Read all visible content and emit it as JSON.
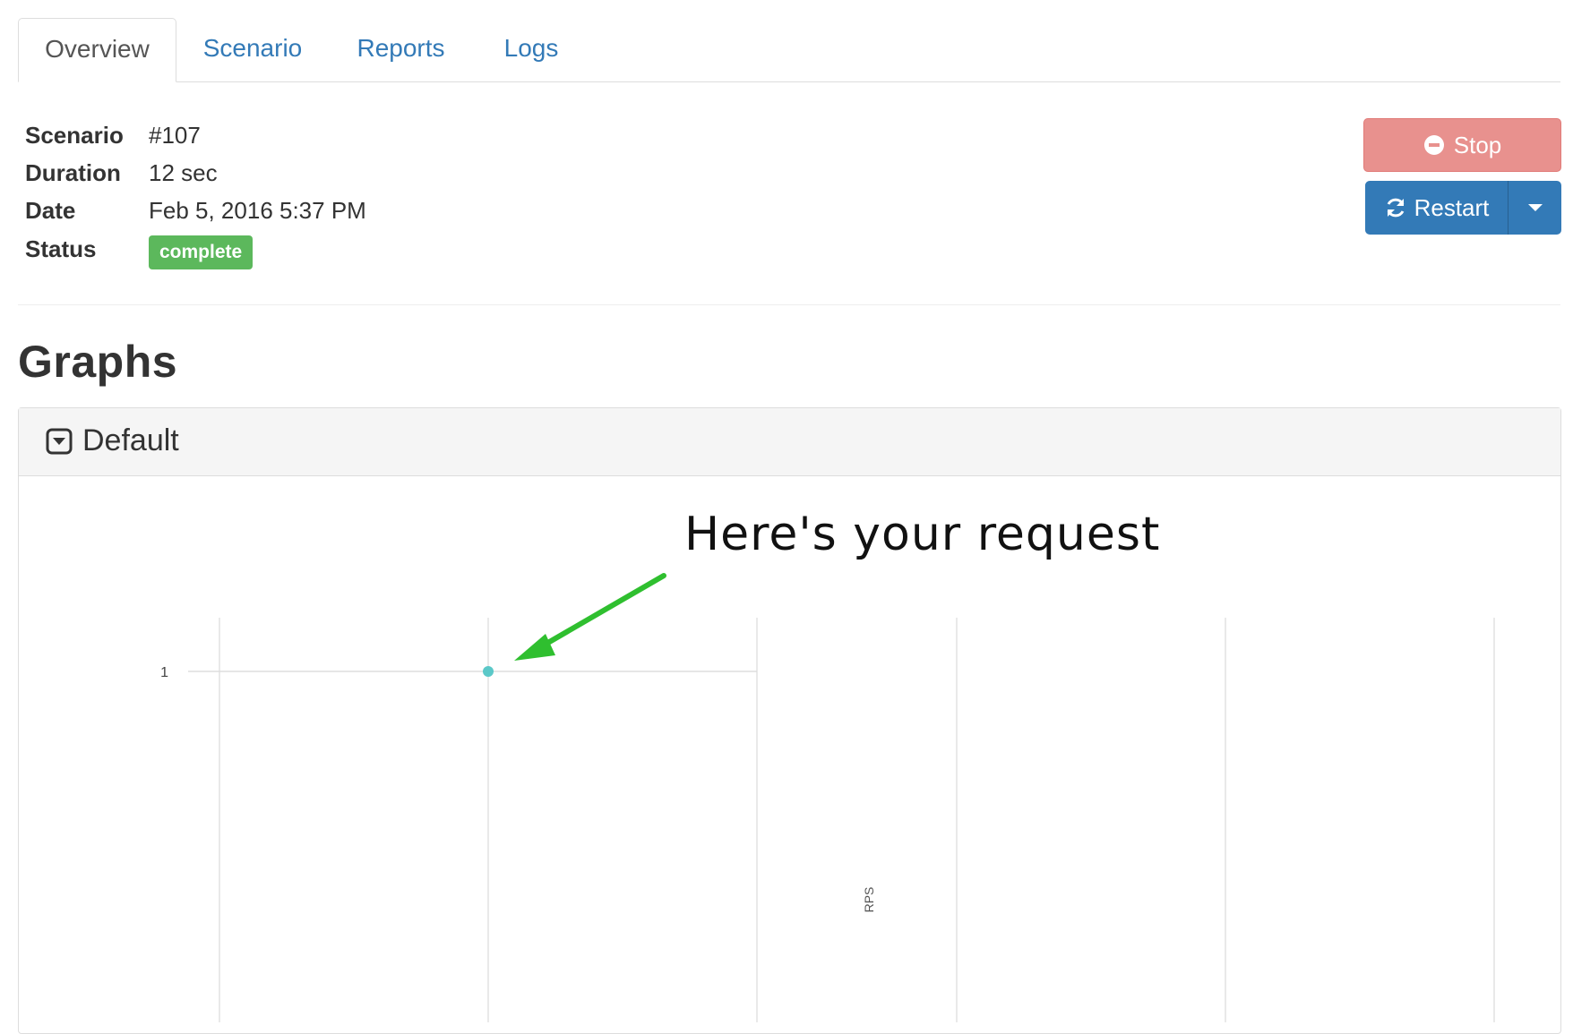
{
  "tabs": [
    {
      "label": "Overview",
      "active": true
    },
    {
      "label": "Scenario",
      "active": false
    },
    {
      "label": "Reports",
      "active": false
    },
    {
      "label": "Logs",
      "active": false
    }
  ],
  "info": {
    "scenario_label": "Scenario",
    "scenario_value": "#107",
    "duration_label": "Duration",
    "duration_value": "12 sec",
    "date_label": "Date",
    "date_value": "Feb 5, 2016 5:37 PM",
    "status_label": "Status",
    "status_value": "complete"
  },
  "actions": {
    "stop_label": "Stop",
    "restart_label": "Restart"
  },
  "graphs": {
    "title": "Graphs",
    "panel_title": "Default"
  },
  "annotation": {
    "text": "Here's your request",
    "arrow_color": "#2fbf2f"
  },
  "colors": {
    "link": "#337ab7",
    "success": "#5cb85c",
    "danger_light": "#e8918e",
    "primary": "#337ab7",
    "point": "#5bc8c8"
  },
  "chart_data": {
    "type": "scatter",
    "ylabel": "RPS",
    "ytick_labels": [
      "1"
    ],
    "points": [
      {
        "x": 1,
        "y": 1
      }
    ]
  }
}
